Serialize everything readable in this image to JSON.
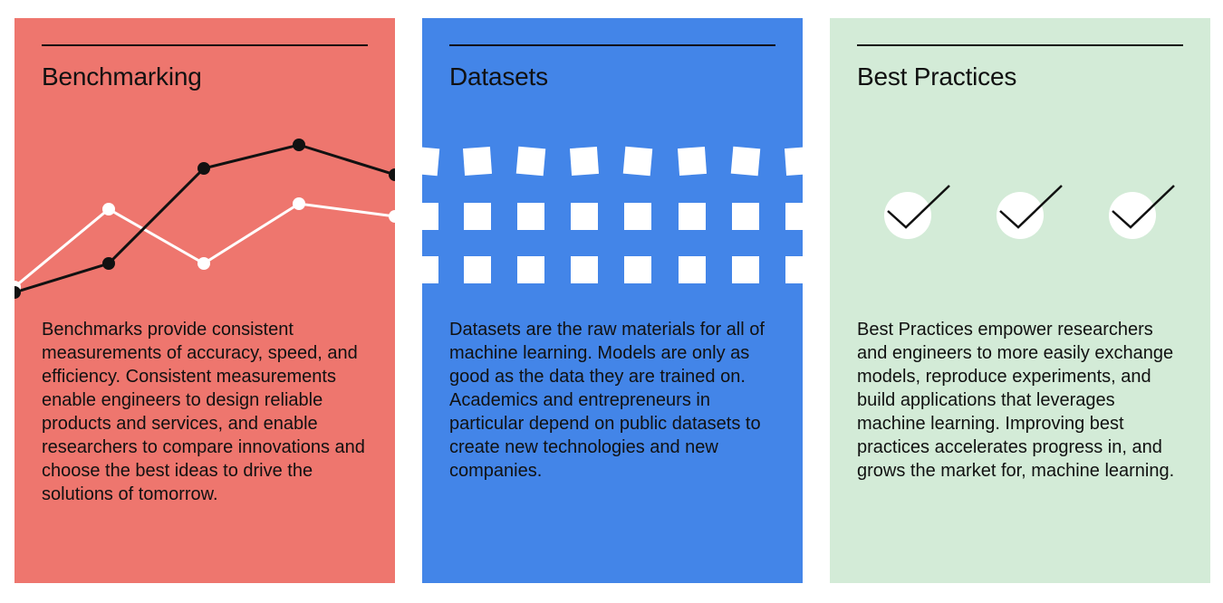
{
  "colors": {
    "benchmarking": "#EE766E",
    "datasets": "#4385E8",
    "best_practices": "#D3EBD7",
    "ink": "#111111",
    "white": "#FFFFFF"
  },
  "cards": [
    {
      "title": "Benchmarking",
      "body": "Benchmarks provide consistent measurements of accuracy, speed, and efficiency. Consistent measurements enable engineers to design reliable products and services, and enable researchers to compare innovations and choose the best ideas to drive the solutions of tomorrow.",
      "illustration": "line-graph-icon"
    },
    {
      "title": "Datasets",
      "body": "Datasets are the raw materials for all of machine learning. Models are only as good as the data they are trained on. Academics and entrepreneurs in particular depend on public datasets to create new technologies and new companies.",
      "illustration": "data-grid-icon"
    },
    {
      "title": "Best Practices",
      "body": "Best Practices empower researchers and engineers to more easily exchange models, reproduce experiments, and build applications that leverages machine learning. Improving best practices accelerates progress in, and grows the market for, machine learning.",
      "illustration": "checkmark-icon"
    }
  ]
}
